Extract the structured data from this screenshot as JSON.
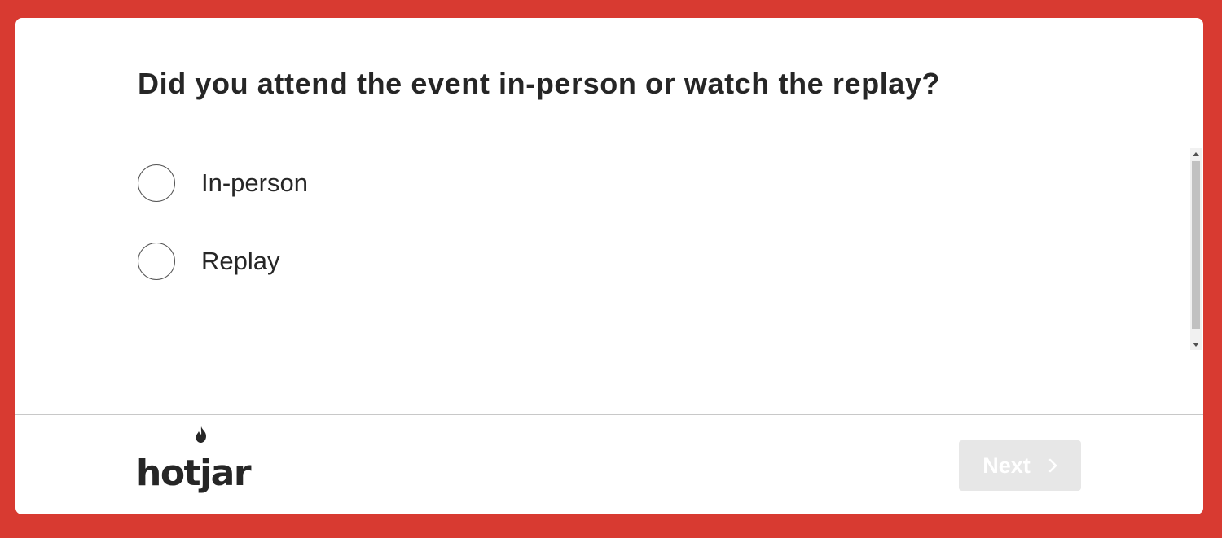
{
  "survey": {
    "question": "Did you attend the event in-person or watch the replay?",
    "options": [
      {
        "label": "In-person",
        "selected": false
      },
      {
        "label": "Replay",
        "selected": false
      }
    ]
  },
  "footer": {
    "logo_text": "hotjar",
    "next_label": "Next",
    "next_enabled": false
  },
  "colors": {
    "background": "#d83a31",
    "card": "#ffffff",
    "text": "#262626",
    "button_disabled": "#e7e7e7"
  },
  "icons": {
    "radio": "radio-circle-icon",
    "next": "chevron-right-icon",
    "logo_flame": "flame-icon"
  }
}
